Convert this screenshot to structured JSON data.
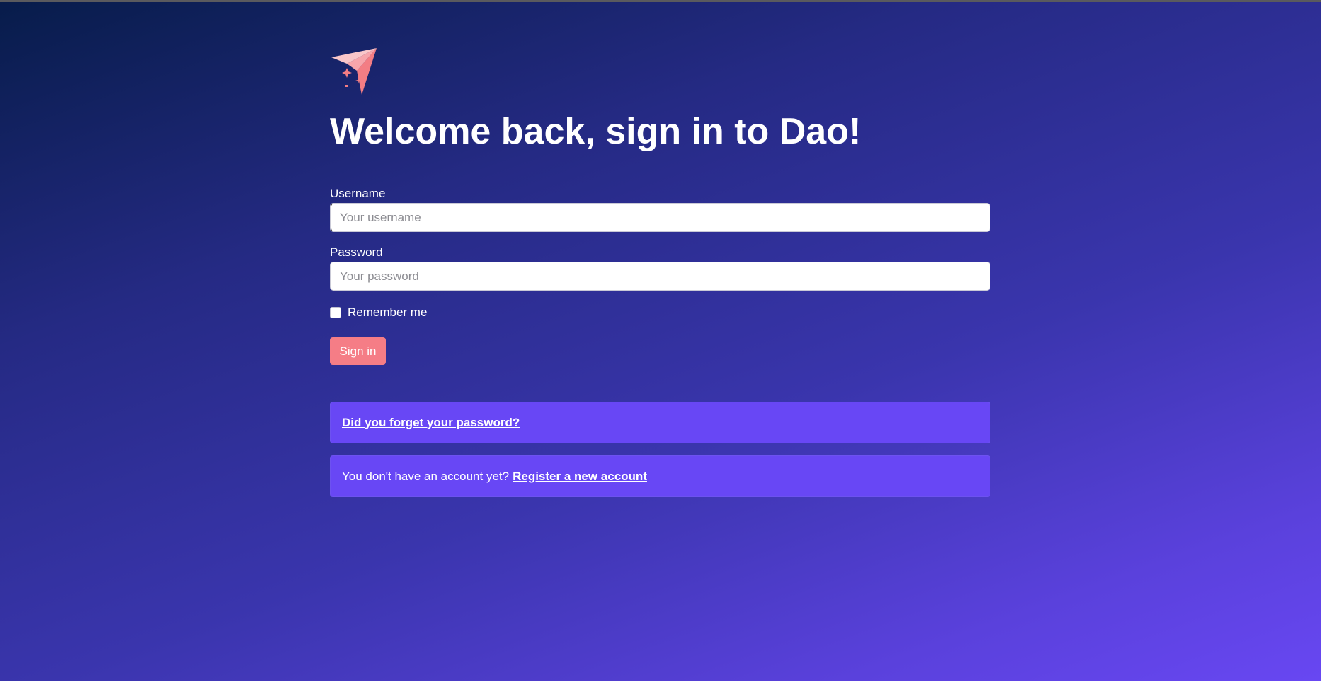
{
  "page": {
    "heading": "Welcome back, sign in to Dao!"
  },
  "logo": {
    "icon": "paper-plane-sparkles-icon",
    "colors": {
      "light": "#f9c6c9",
      "accent": "#f37d84"
    }
  },
  "form": {
    "username": {
      "label": "Username",
      "placeholder": "Your username",
      "value": ""
    },
    "password": {
      "label": "Password",
      "placeholder": "Your password",
      "value": ""
    },
    "remember": {
      "label": "Remember me",
      "checked": false
    },
    "submit_label": "Sign in"
  },
  "links": {
    "forgot": "Did you forget your password?",
    "register_prompt": "You don't have an account yet?",
    "register_link": "Register a new account"
  },
  "colors": {
    "button": "#f57d86",
    "notice_bg": "#6847f5",
    "background_start": "#071c4a",
    "background_end": "#6847f2"
  }
}
